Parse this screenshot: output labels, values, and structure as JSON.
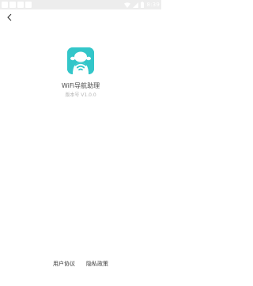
{
  "status_bar": {
    "time": "8:39"
  },
  "header": {
    "back_icon": "chevron-left-icon"
  },
  "app": {
    "name": "WiFi导航助理",
    "version": "版本号 V1.0.0",
    "icon": "robot-wifi-icon",
    "icon_bg_color": "#33c6c9"
  },
  "footer": {
    "user_agreement": "用户协议",
    "privacy_policy": "隐私政策"
  }
}
